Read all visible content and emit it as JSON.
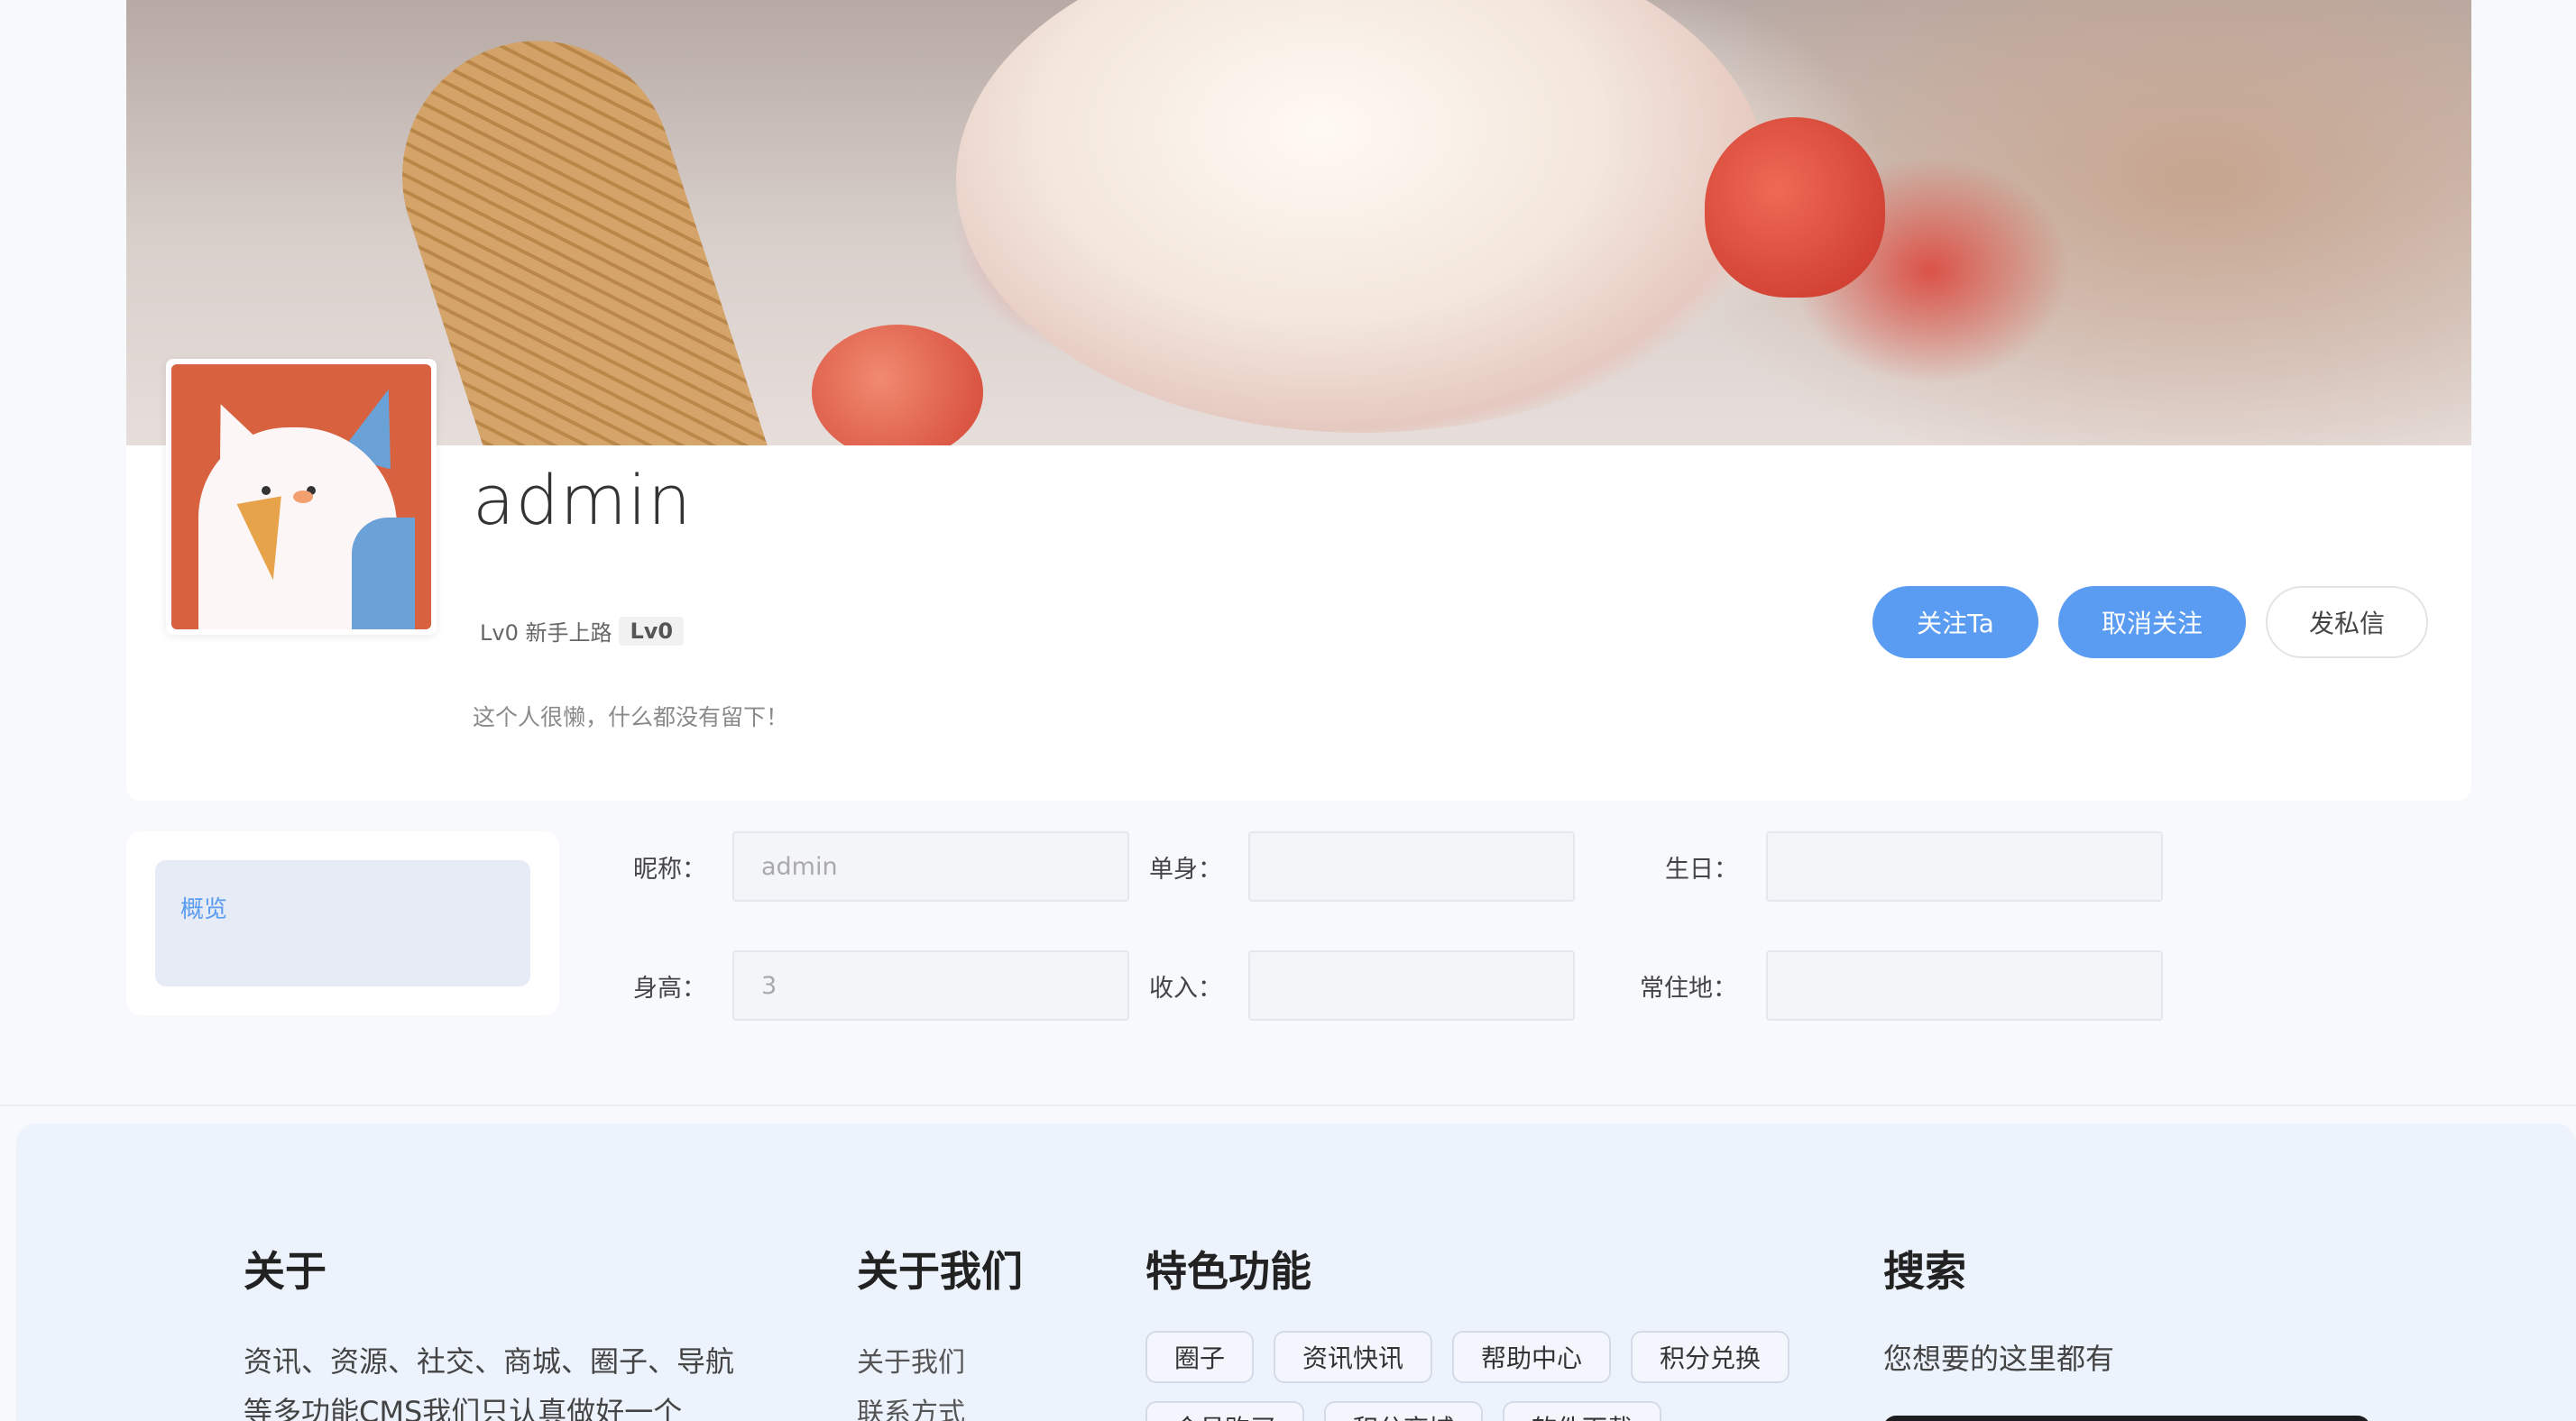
{
  "profile": {
    "username": "admin",
    "level_text": "Lv0 新手上路",
    "level_badge": "Lv0",
    "bio": "这个人很懒，什么都没有留下！",
    "buttons": {
      "follow": "关注Ta",
      "unfollow": "取消关注",
      "message": "发私信"
    }
  },
  "sidebar": {
    "items": [
      {
        "label": "概览"
      }
    ]
  },
  "details": {
    "nickname_label": "昵称：",
    "nickname_value": "admin",
    "single_label": "单身：",
    "single_value": "",
    "birthday_label": "生日：",
    "birthday_value": "",
    "height_label": "身高：",
    "height_value": "3",
    "income_label": "收入：",
    "income_value": "",
    "residence_label": "常住地：",
    "residence_value": ""
  },
  "footer": {
    "about_title": "关于",
    "about_text": "资讯、资源、社交、商城、圈子、导航等多功能CMS我们只认真做好一个",
    "aboutus_title": "关于我们",
    "aboutus_links": [
      "关于我们",
      "联系方式"
    ],
    "features_title": "特色功能",
    "features_tags": [
      "圈子",
      "资讯快讯",
      "帮助中心",
      "积分兑换",
      "会员购买",
      "积分商城",
      "软件下载"
    ],
    "search_title": "搜索",
    "search_desc": "您想要的这里都有"
  },
  "colors": {
    "accent": "#5a9cf2",
    "background": "#f7f9fc",
    "footer_bg": "#edf3fd"
  }
}
